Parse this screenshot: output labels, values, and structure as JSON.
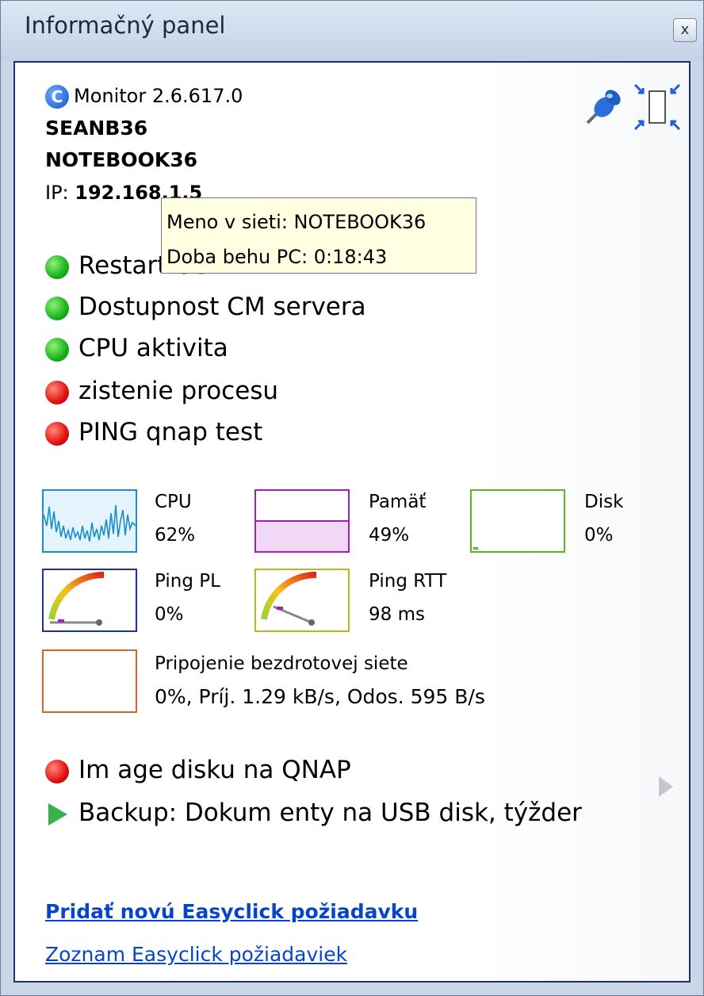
{
  "window": {
    "title": "Informačný panel",
    "close_glyph": "x"
  },
  "header": {
    "app_logo_letter": "C",
    "app_name": "Monitor 2.6.617.0",
    "user": "SEANB36",
    "computer": "NOTEBOOK36",
    "ip_label": "IP:",
    "ip_value": "192.168.1.5",
    "pin_icon": "pushpin-icon",
    "compact_icon": "compact-view-icon"
  },
  "tooltip": {
    "line1": "Meno v sieti: NOTEBOOK36",
    "line2": "Doba behu PC: 0:18:43"
  },
  "checks": [
    {
      "label": "Restart OS",
      "status": "green"
    },
    {
      "label": "Dostupnost CM servera",
      "status": "green"
    },
    {
      "label": "CPU aktivita",
      "status": "green"
    },
    {
      "label": "zistenie procesu",
      "status": "red"
    },
    {
      "label": "PING  qnap test",
      "status": "red"
    }
  ],
  "metrics": {
    "cpu": {
      "name": "CPU",
      "value": "62%",
      "color": "#1a8fd0",
      "level": 0.62
    },
    "memory": {
      "name": "Pamäť",
      "value": "49%",
      "color": "#a020c0",
      "level": 0.49
    },
    "disk": {
      "name": "Disk",
      "value": "0%",
      "color": "#58b820",
      "level": 0
    },
    "ping_pl": {
      "name": "Ping PL",
      "value": "0%",
      "color": "#1c2eb0"
    },
    "ping_rtt": {
      "name": "Ping RTT",
      "value": "98 ms",
      "color": "#b8b820"
    },
    "network": {
      "name": "Pripojenie bezdrotovej siete",
      "value": "0%, Príj. 1.29 kB/s, Odos. 595 B/s",
      "color": "#d0692a"
    }
  },
  "tasks": [
    {
      "label": "Im age disku na QNAP",
      "icon": "red-dot"
    },
    {
      "label": "Backup: Dokum enty na USB disk, týžder",
      "icon": "play-arrow-icon"
    }
  ],
  "links": {
    "add_request": "Pridať novú Easyclick požiadavku",
    "list_requests": "Zoznam Easyclick požiadaviek"
  }
}
